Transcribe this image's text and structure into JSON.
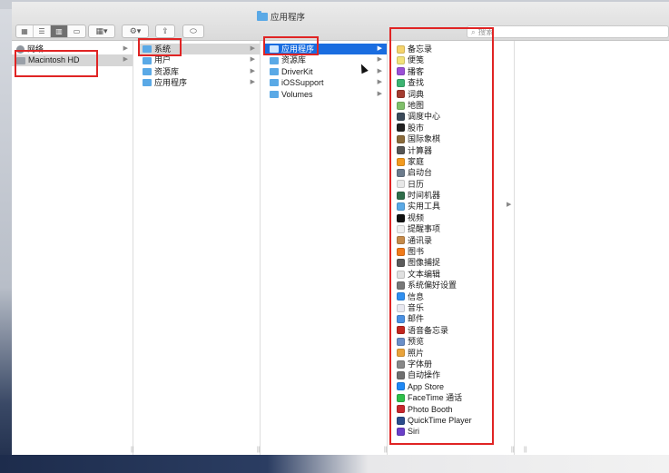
{
  "window": {
    "title": "应用程序"
  },
  "toolbar": {
    "view_buttons": [
      "icons-view-icon",
      "list-view-icon",
      "column-view-icon",
      "gallery-view-icon"
    ],
    "search_placeholder": "搜索"
  },
  "sidebar": {
    "items": [
      {
        "label": "网络",
        "icon": "network-icon"
      },
      {
        "label": "Macintosh HD",
        "icon": "hard-drive-icon",
        "selected": true
      }
    ]
  },
  "column1": {
    "items": [
      {
        "label": "系统",
        "selected": true
      },
      {
        "label": "用户"
      },
      {
        "label": "资源库"
      },
      {
        "label": "应用程序"
      }
    ]
  },
  "column2": {
    "items": [
      {
        "label": "应用程序",
        "selected": true
      },
      {
        "label": "资源库"
      },
      {
        "label": "DriverKit"
      },
      {
        "label": "iOSSupport"
      },
      {
        "label": "Volumes"
      }
    ]
  },
  "column3": {
    "items": [
      {
        "label": "备忘录",
        "color": "#f5d36b"
      },
      {
        "label": "便笺",
        "color": "#f2e27a"
      },
      {
        "label": "播客",
        "color": "#9b4fd6"
      },
      {
        "label": "查找",
        "color": "#3cb371"
      },
      {
        "label": "词典",
        "color": "#a33b2f"
      },
      {
        "label": "地图",
        "color": "#7fbf6a"
      },
      {
        "label": "调度中心",
        "color": "#3b4a5a"
      },
      {
        "label": "股市",
        "color": "#222222"
      },
      {
        "label": "国际象棋",
        "color": "#8a6a3a"
      },
      {
        "label": "计算器",
        "color": "#555555"
      },
      {
        "label": "家庭",
        "color": "#f29a1f"
      },
      {
        "label": "启动台",
        "color": "#6b7b8c"
      },
      {
        "label": "日历",
        "color": "#e8e8e8"
      },
      {
        "label": "时间机器",
        "color": "#2f6d4a"
      },
      {
        "label": "实用工具",
        "color": "#5aa9e6"
      },
      {
        "label": "视频",
        "color": "#111111"
      },
      {
        "label": "提醒事项",
        "color": "#eeeeee"
      },
      {
        "label": "通讯录",
        "color": "#c58a4a"
      },
      {
        "label": "图书",
        "color": "#f07a1a"
      },
      {
        "label": "图像捕捉",
        "color": "#5a5a5a"
      },
      {
        "label": "文本编辑",
        "color": "#e0e0e0"
      },
      {
        "label": "系统偏好设置",
        "color": "#777777"
      },
      {
        "label": "信息",
        "color": "#2f8ff0"
      },
      {
        "label": "音乐",
        "color": "#e8e8f0"
      },
      {
        "label": "邮件",
        "color": "#4a90e2"
      },
      {
        "label": "语音备忘录",
        "color": "#c2261f"
      },
      {
        "label": "预览",
        "color": "#6a8fc8"
      },
      {
        "label": "照片",
        "color": "#e9a33a"
      },
      {
        "label": "字体册",
        "color": "#888888"
      },
      {
        "label": "自动操作",
        "color": "#6f6f6f"
      },
      {
        "label": "App Store",
        "color": "#1e88f5"
      },
      {
        "label": "FaceTime 通话",
        "color": "#2fbf4a"
      },
      {
        "label": "Photo Booth",
        "color": "#c8282e"
      },
      {
        "label": "QuickTime Player",
        "color": "#2b4c8c"
      },
      {
        "label": "Siri",
        "color": "#6a3fc8"
      }
    ]
  }
}
